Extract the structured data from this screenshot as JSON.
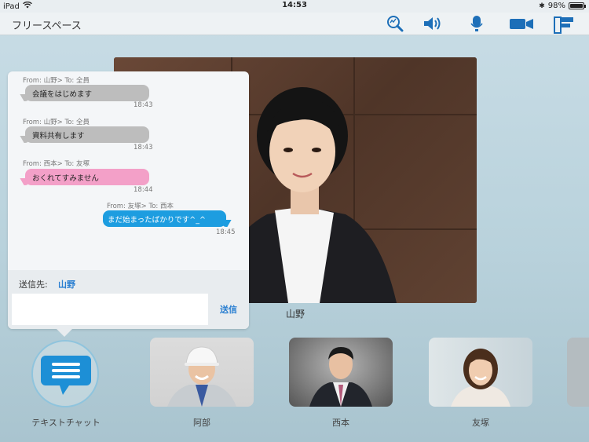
{
  "status_bar": {
    "carrier": "iPad",
    "time": "14:53",
    "battery": "98%",
    "battery_level": 0.98
  },
  "nav": {
    "title": "フリースペース",
    "icons": [
      "search-zoom-icon",
      "speaker-icon",
      "microphone-icon",
      "video-camera-icon",
      "screen-share-icon"
    ],
    "accent_color": "#1d6fb8"
  },
  "main_video": {
    "participant_name": "山野"
  },
  "chat": {
    "messages": [
      {
        "meta": "From: 山野> To:  全員",
        "text": "会議をはじめます",
        "time": "18:43",
        "color": "gray",
        "side": "left"
      },
      {
        "meta": "From: 山野> To:  全員",
        "text": "資料共有します",
        "time": "18:43",
        "color": "gray",
        "side": "left"
      },
      {
        "meta": "From: 西本> To:  友塚",
        "text": "おくれてすみません",
        "time": "18:44",
        "color": "pink",
        "side": "left"
      },
      {
        "meta": "From: 友塚> To:  西本",
        "text": "まだ始まったばかりです^_^",
        "time": "18:45",
        "color": "blue",
        "side": "right"
      }
    ],
    "recipient_label": "送信先:",
    "recipient_name": "山野",
    "input_value": "",
    "send_label": "送信"
  },
  "bottom": {
    "text_chat_label": "テキストチャット",
    "participants": [
      {
        "name": "阿部"
      },
      {
        "name": "西本"
      },
      {
        "name": "友塚"
      }
    ]
  }
}
